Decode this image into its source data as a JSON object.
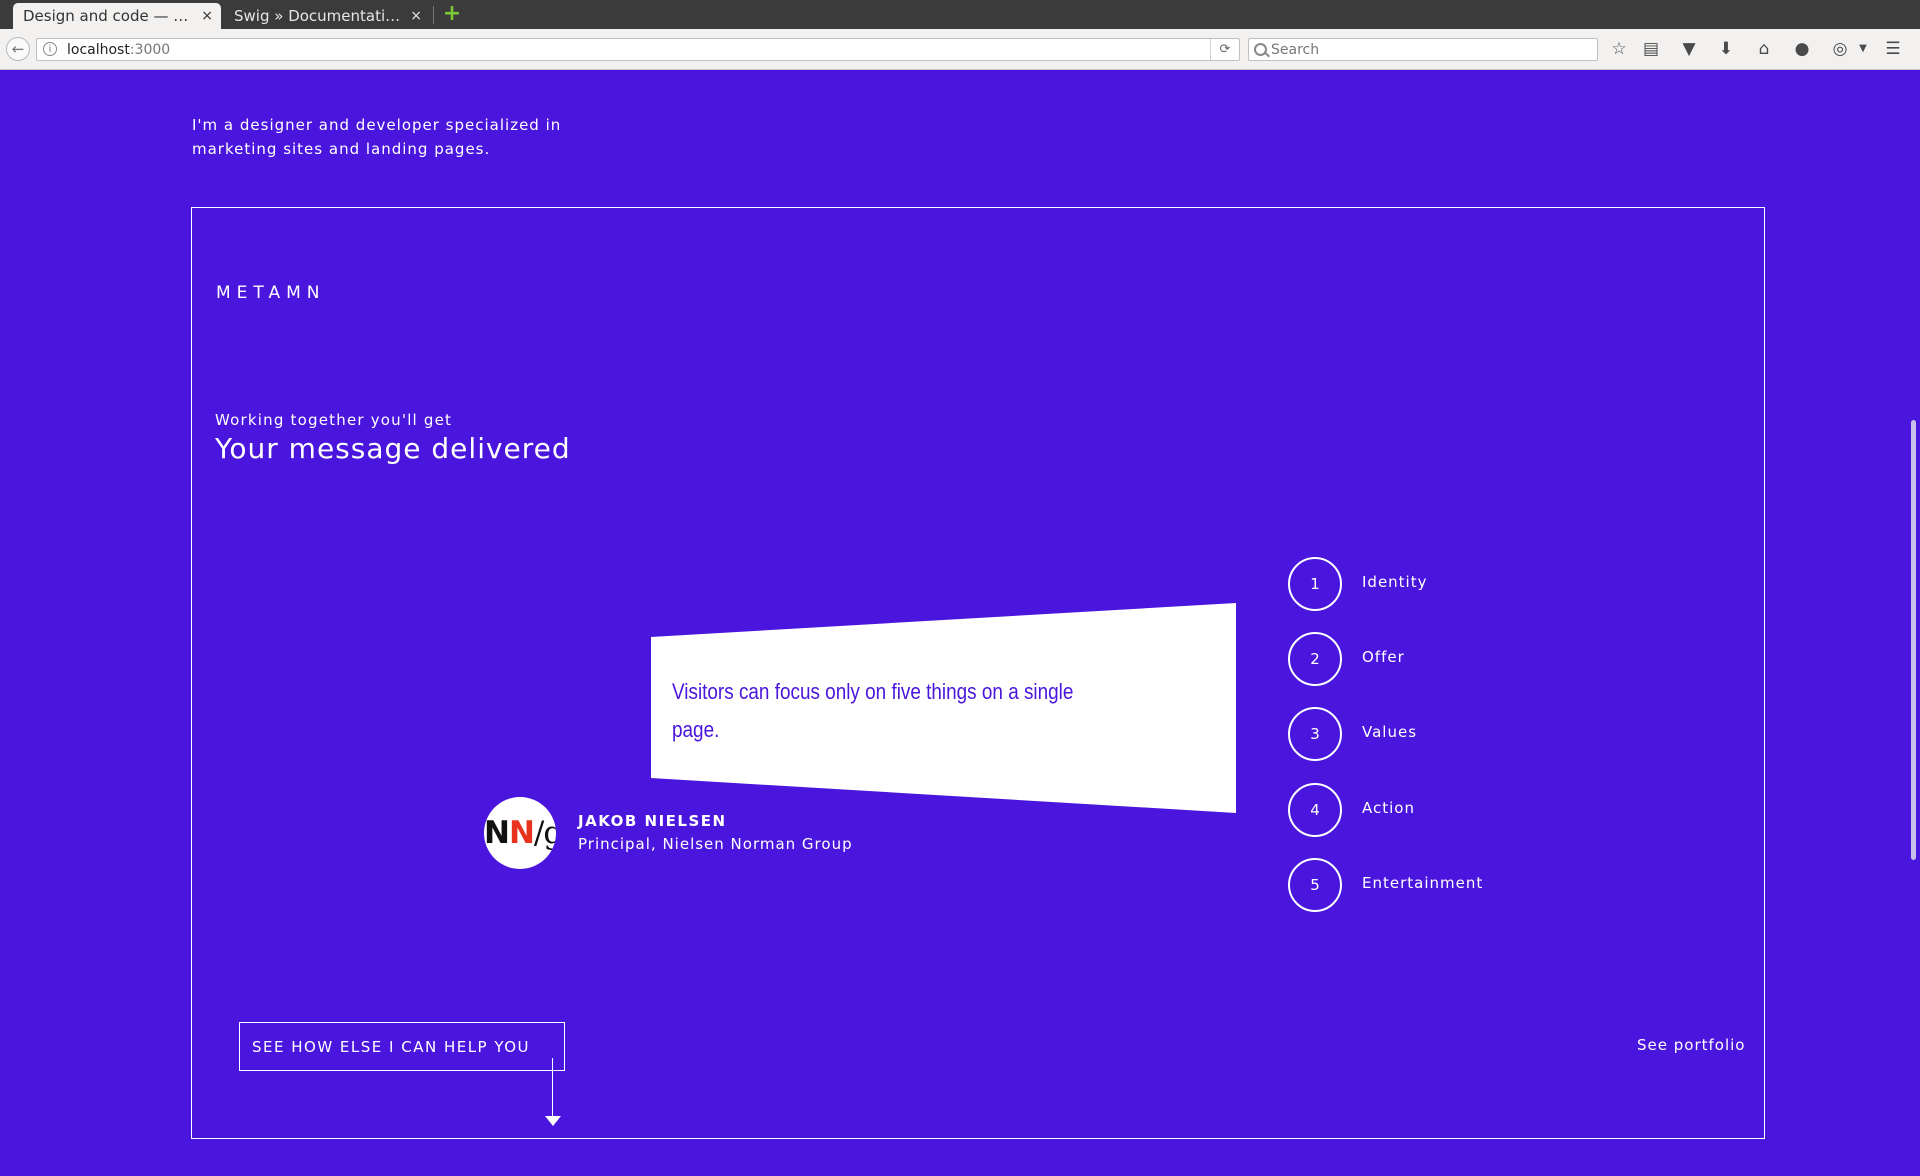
{
  "browser": {
    "tabs": [
      {
        "title": "Design and code — Met...",
        "close": "×",
        "active": true
      },
      {
        "title": "Swig » Documentation »...",
        "close": "×",
        "active": false
      }
    ],
    "new_tab": "+",
    "url_host": "localhost",
    "url_port": ":3000",
    "search_placeholder": "Search",
    "toolbar_icons": [
      "bookmark-star-icon",
      "reading-list-icon",
      "pocket-icon",
      "download-icon",
      "home-icon",
      "chat-icon",
      "adblock-icon",
      "menu-icon"
    ]
  },
  "page": {
    "intro": "I'm a designer and developer specialized in marketing sites and landing pages.",
    "logo": "METAMN",
    "eyebrow": "Working together you'll get",
    "headline": "Your message delivered",
    "quote": "Visitors can focus only on five things on a single page.",
    "author": {
      "logo_n1": "N",
      "logo_n2": "N",
      "logo_g": "/g",
      "name": "JAKOB NIELSEN",
      "role": "Principal, Nielsen Norman Group"
    },
    "pillars": [
      {
        "num": "1",
        "label": "Identity"
      },
      {
        "num": "2",
        "label": "Offer"
      },
      {
        "num": "3",
        "label": "Values"
      },
      {
        "num": "4",
        "label": "Action"
      },
      {
        "num": "5",
        "label": "Entertainment"
      }
    ],
    "cta": "SEE HOW ELSE I CAN HELP YOU",
    "portfolio": "See portfolio"
  },
  "colors": {
    "background": "#4a15dc",
    "foreground": "#ffffff",
    "logo_accent": "#e8321e"
  }
}
